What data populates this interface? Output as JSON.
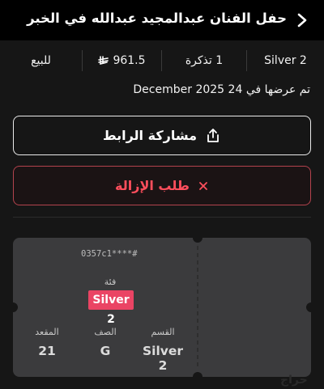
{
  "header": {
    "title": "حفل الفنان عبدالمجيد عبدالله في الخبر"
  },
  "info": {
    "class": "Silver 2",
    "tickets": "1 تذكرة",
    "price": "961.5",
    "status": "للبيع"
  },
  "listed_text": "تم عرضها في 24 December 2025",
  "actions": {
    "share_label": "مشاركة الرابط",
    "remove_label": "طلب الإزالة"
  },
  "ticket": {
    "code": "0357c1****#",
    "class_label": "فئة",
    "class_value": "Silver 2",
    "section_label": "القسم",
    "section_value": "Silver 2",
    "row_label": "الصف",
    "row_value": "G",
    "seat_label": "المقعد",
    "seat_value": "21"
  },
  "brand": {
    "logo": "حراج"
  },
  "colors": {
    "accent": "#ea4464",
    "danger": "#ff4e5c",
    "background": "#161616"
  }
}
